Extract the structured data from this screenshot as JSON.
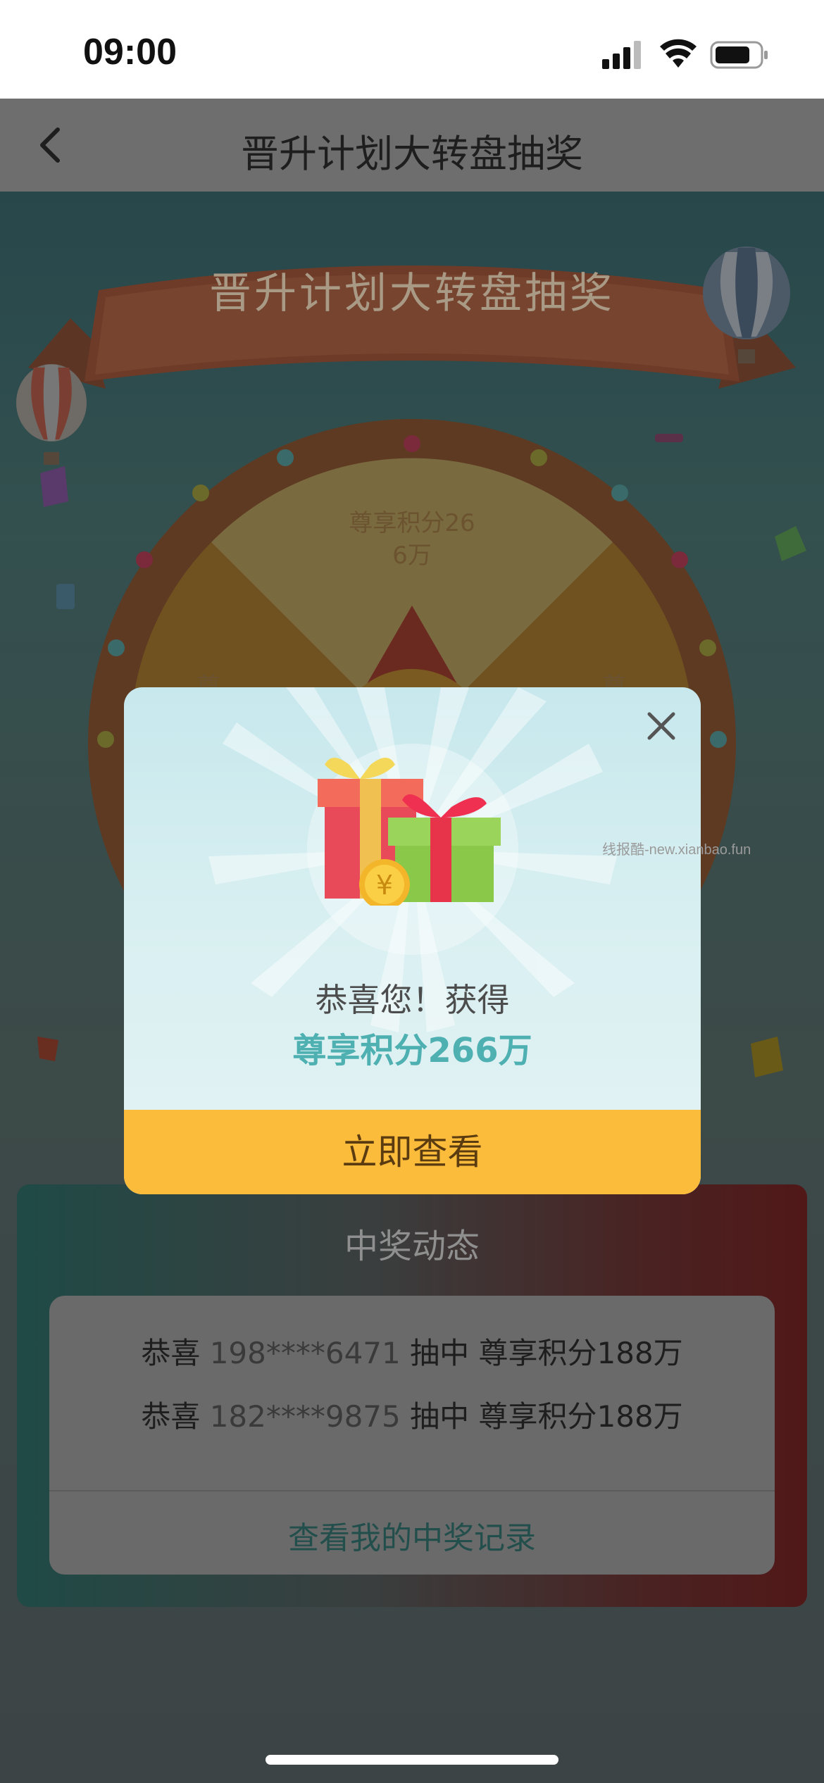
{
  "status_bar": {
    "time": "09:00"
  },
  "nav": {
    "title": "晋升计划大转盘抽奖",
    "back_icon": "chevron-left-icon"
  },
  "banner": {
    "title": "晋升计划大转盘抽奖"
  },
  "wheel": {
    "top_segment_label_line1": "尊享积分26",
    "top_segment_label_line2": "6万",
    "left_segment_partial": "尊",
    "right_segment_partial": "尊"
  },
  "modal": {
    "congrats_text": "恭喜您！获得",
    "prize_text": "尊享积分266万",
    "button_label": "立即查看",
    "close_icon": "close-icon",
    "gift_icon": "gift-box-icon"
  },
  "winners": {
    "title": "中奖动态",
    "rows": [
      {
        "prefix": "恭喜",
        "phone": "198****6471",
        "middle": "抽中",
        "prize": "尊享积分188万"
      },
      {
        "prefix": "恭喜",
        "phone": "182****9875",
        "middle": "抽中",
        "prize": "尊享积分188万"
      }
    ],
    "records_link": "查看我的中奖记录"
  },
  "watermark": "线报酷-new.xianbao.fun",
  "colors": {
    "accent_teal": "#4fb0b2",
    "button_yellow": "#fcbc3b",
    "nav_gray": "#6e6e6e"
  }
}
